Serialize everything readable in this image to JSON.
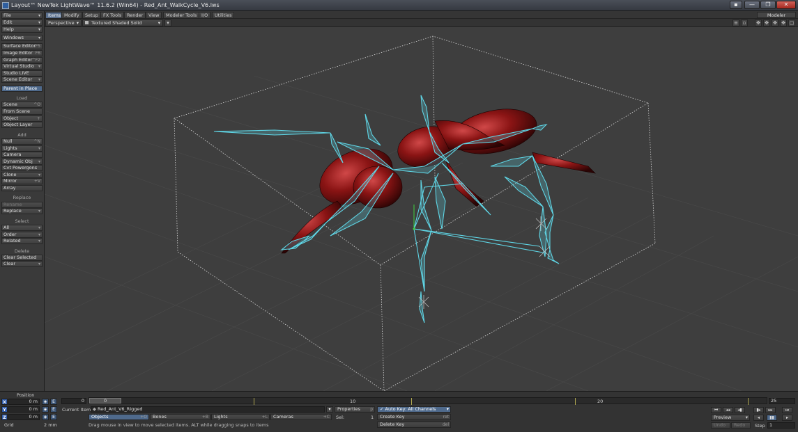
{
  "window": {
    "title": "Layout™ NewTek LightWave™ 11.6.2 (Win64) - Red_Ant_WalkCycle_V6.lws",
    "controls": [
      "▪",
      "—",
      "❐",
      "✕"
    ]
  },
  "tabs": [
    "Items",
    "Modify",
    "Setup",
    "FX Tools",
    "Render",
    "View",
    "Modeler Tools",
    "I/O",
    "Utilities"
  ],
  "modeler_label": "Modeler",
  "left_panel": {
    "top_menus": [
      {
        "label": "File",
        "arrow": "▾"
      },
      {
        "label": "Edit",
        "arrow": "▾"
      },
      {
        "label": "Help",
        "arrow": "▾"
      }
    ],
    "windows_label": "Windows",
    "editors": [
      {
        "label": "Surface Editor",
        "key": "F5"
      },
      {
        "label": "Image Editor",
        "key": "F6"
      },
      {
        "label": "Graph Editor",
        "key": "^F2"
      },
      {
        "label": "Virtual Studio",
        "key": "▾"
      },
      {
        "label": "Studio LIVE",
        "key": ""
      },
      {
        "label": "Scene Editor",
        "key": "▾"
      }
    ],
    "parent_in_place": "Parent in Place",
    "load_header": "Load",
    "load_items": [
      {
        "label": "Scene",
        "key": "^O"
      },
      {
        "label": "From Scene",
        "key": ""
      },
      {
        "label": "Object",
        "key": "+"
      },
      {
        "label": "Object Layer",
        "key": ""
      }
    ],
    "add_header": "Add",
    "add_items": [
      {
        "label": "Null",
        "key": "^N"
      },
      {
        "label": "Lights",
        "key": "▾"
      },
      {
        "label": "Camera",
        "key": ""
      },
      {
        "label": "Dynamic Obj",
        "key": "▾"
      },
      {
        "label": "Cvt Powergons",
        "key": ""
      },
      {
        "label": "Clone",
        "key": "▾"
      },
      {
        "label": "Mirror",
        "key": "+V"
      },
      {
        "label": "Array",
        "key": ""
      }
    ],
    "replace_header": "Replace",
    "replace_items": [
      {
        "label": "Rename",
        "key": ""
      },
      {
        "label": "Replace",
        "key": "▾"
      }
    ],
    "select_header": "Select",
    "select_items": [
      {
        "label": "All",
        "key": "▾"
      },
      {
        "label": "Order",
        "key": "▾"
      },
      {
        "label": "Related",
        "key": "▾"
      }
    ],
    "delete_header": "Delete",
    "delete_items": [
      {
        "label": "Clear Selected",
        "key": ""
      },
      {
        "label": "Clear",
        "key": "▾"
      }
    ]
  },
  "viewport_toolbar": {
    "view_mode": "Perspective",
    "render_mode": "Textured Shaded Solid"
  },
  "bottom": {
    "position_label": "Position",
    "x_label": "X",
    "x_value": "0 m",
    "y_label": "Y",
    "y_value": "0 m",
    "z_label": "Z",
    "z_value": "0 m",
    "grid_label": "Grid",
    "grid_value": "2 mm",
    "frame_start": "0",
    "current_frame": "0",
    "timeline_labels": [
      "0",
      "10",
      "20"
    ],
    "frame_end": "25",
    "current_item_label": "Current Item",
    "current_item_value": "Red_Ant_V6_Rigged",
    "properties_label": "Properties",
    "sel_label": "Sel:",
    "sel_value": "1",
    "auto_key_label": "Auto Key: All Channels",
    "create_key": "Create Key",
    "delete_key": "Delete Key",
    "objects_btn": "Objects",
    "bones_btn": "Bones",
    "lights_btn": "Lights",
    "cameras_btn": "Cameras",
    "status_text": "Drag mouse in view to move selected items. ALT while dragging snaps to items",
    "preview_label": "Preview",
    "undo_label": "Undo",
    "redo_label": "Redo",
    "step_label": "Step",
    "step_value": "1"
  },
  "colors": {
    "bones": "#5fd6e6",
    "ant_body": "#8a1414",
    "bounding_box": "#d8d8d8",
    "active_button": "#4f6a8c",
    "axis_x": "#2f5aa8",
    "axis_y": "#2f5aa8",
    "axis_z": "#2f5aa8"
  }
}
